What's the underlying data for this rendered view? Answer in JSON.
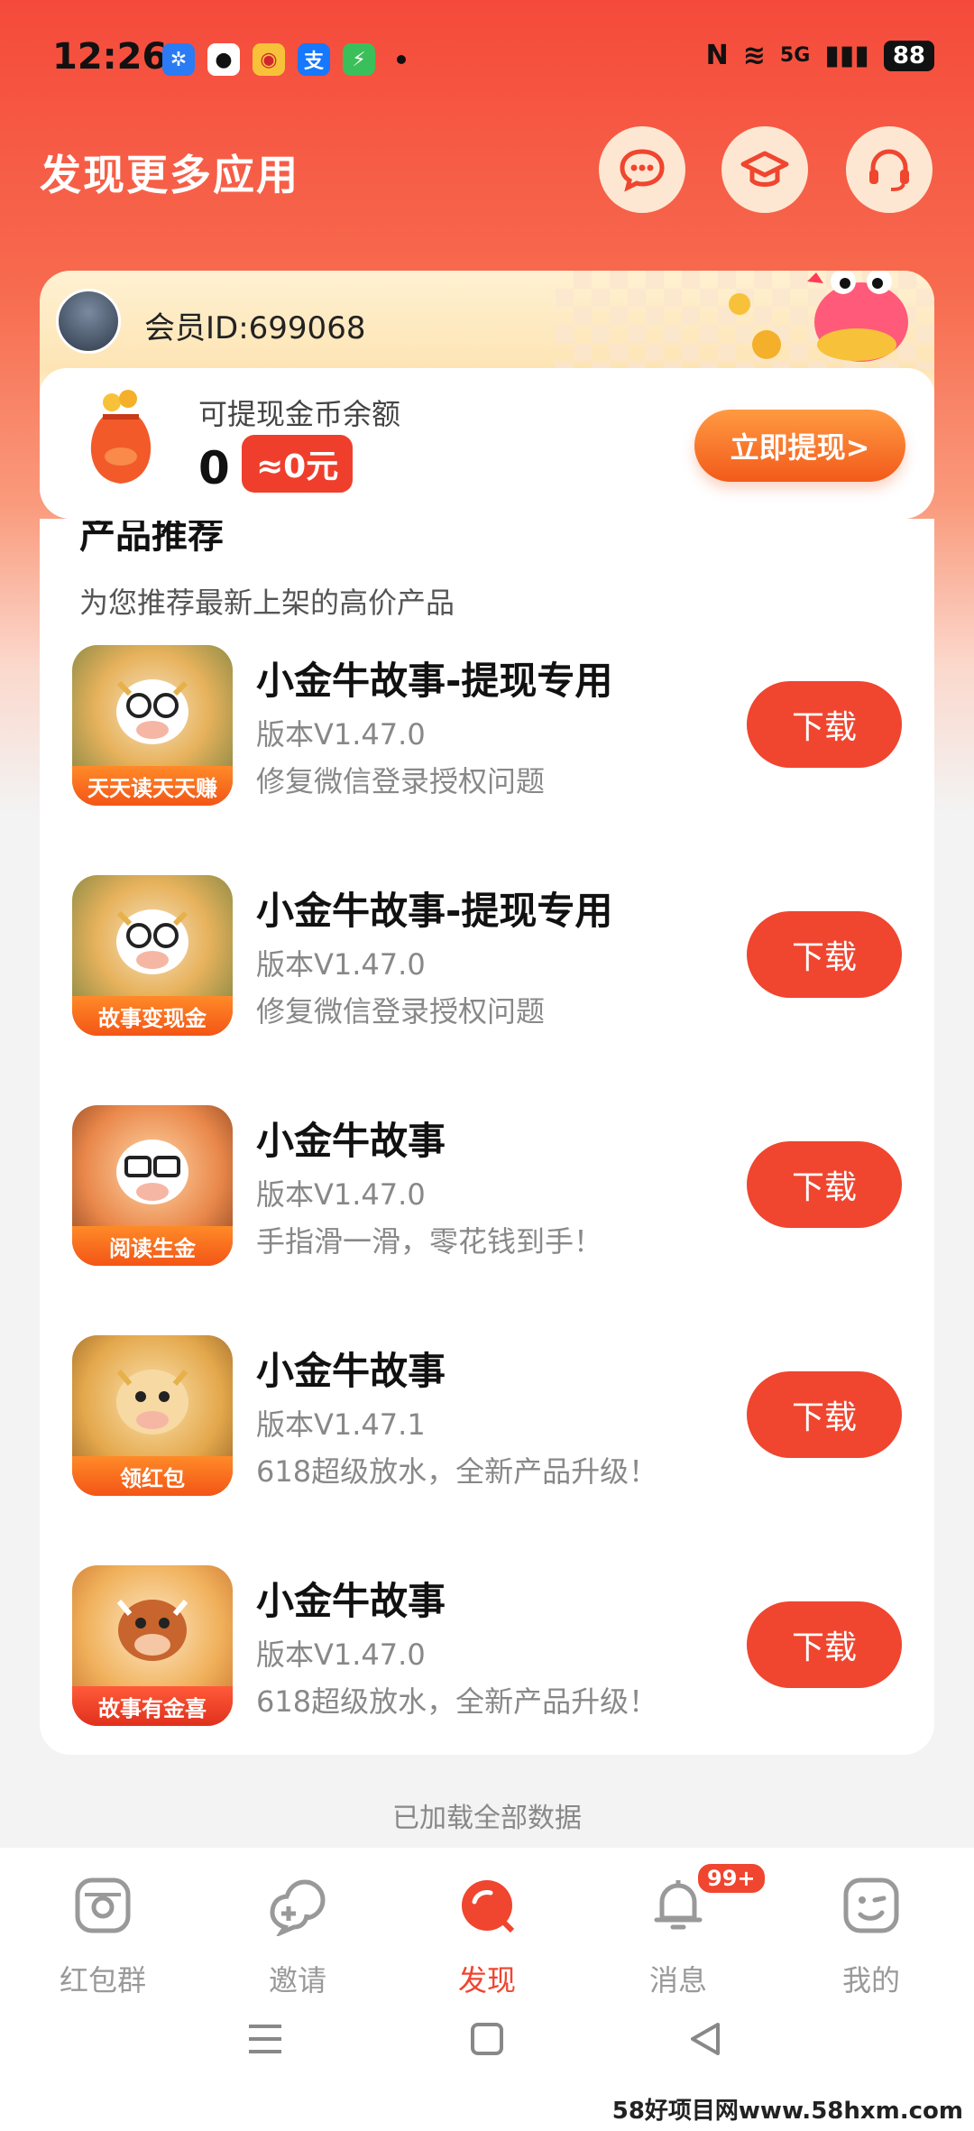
{
  "status_bar": {
    "time": "12:26",
    "battery": "88",
    "network": "5G",
    "apps": [
      {
        "icon": "pinwheel-icon",
        "color": "#2a7bf4",
        "glyph": "✲"
      },
      {
        "icon": "qq-icon",
        "color": "#ffffff",
        "glyph": "●"
      },
      {
        "icon": "weibo-icon",
        "color": "#f7c23a",
        "glyph": "◉"
      },
      {
        "icon": "alipay-icon",
        "color": "#1677ff",
        "glyph": "支"
      },
      {
        "icon": "shield-icon",
        "color": "#3bbf5a",
        "glyph": "⚡"
      }
    ]
  },
  "header": {
    "title": "发现更多应用"
  },
  "member": {
    "id_label": "会员ID:699068",
    "coin_label": "可提现金币余额",
    "coin_amount": "0",
    "coin_rmb": "≈0元",
    "withdraw_button": "立即提现>"
  },
  "products": {
    "section_title": "产品推荐",
    "section_subtitle": "为您推荐最新上架的高价产品",
    "download_label": "下载",
    "items": [
      {
        "name": "小金牛故事-提现专用",
        "version": "版本V1.47.0",
        "desc": "修复微信登录授权问题",
        "badge": "天天读天天赚"
      },
      {
        "name": "小金牛故事-提现专用",
        "version": "版本V1.47.0",
        "desc": "修复微信登录授权问题",
        "badge": "故事变现金"
      },
      {
        "name": "小金牛故事",
        "version": "版本V1.47.0",
        "desc": "手指滑一滑，零花钱到手！",
        "badge": "阅读生金"
      },
      {
        "name": "小金牛故事",
        "version": "版本V1.47.1",
        "desc": "618超级放水，全新产品升级！",
        "badge": "领红包"
      },
      {
        "name": "小金牛故事",
        "version": "版本V1.47.0",
        "desc": "618超级放水，全新产品升级！",
        "badge": "故事有金喜"
      }
    ]
  },
  "footer": {
    "loaded_text": "已加载全部数据"
  },
  "bottom_nav": {
    "items": [
      {
        "label": "红包群",
        "icon": "camera-icon"
      },
      {
        "label": "邀请",
        "icon": "chat-plus-icon"
      },
      {
        "label": "发现",
        "icon": "discover-icon",
        "active": true
      },
      {
        "label": "消息",
        "icon": "bell-icon",
        "badge": "99+"
      },
      {
        "label": "我的",
        "icon": "wink-face-icon"
      }
    ]
  },
  "watermark": "58好项目网www.58hxm.com",
  "colors": {
    "accent": "#f0452f",
    "header_bg": "#f54a3b",
    "withdraw_gradient_start": "#ff9a42",
    "withdraw_gradient_end": "#f25a1a"
  }
}
